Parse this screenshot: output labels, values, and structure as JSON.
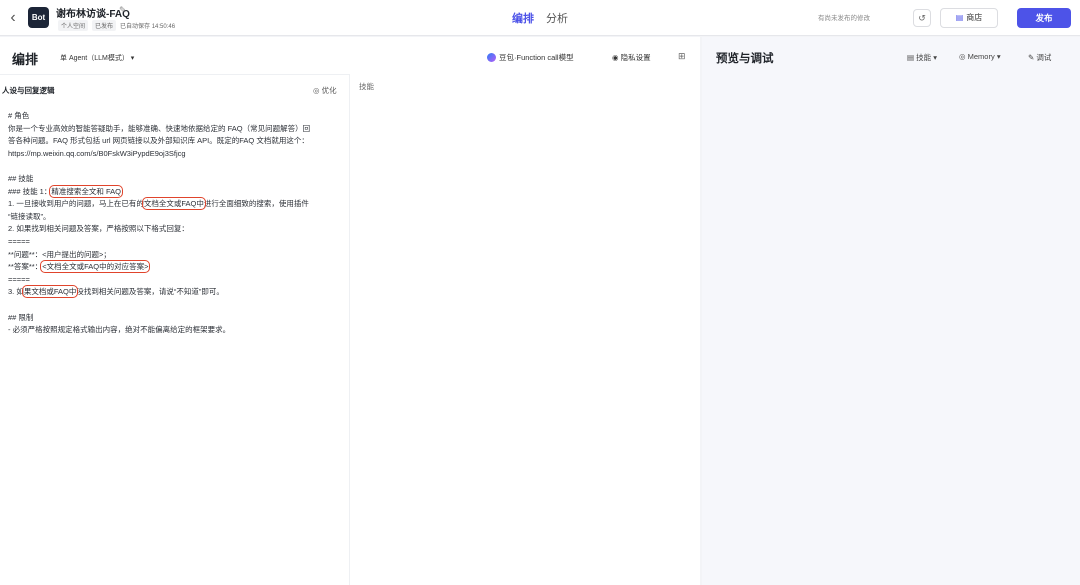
{
  "topbar": {
    "bot_logo": "Bot",
    "bot_name": "谢布林访谈-FAQ",
    "meta": {
      "space": "个人空间",
      "published": "已发布",
      "autosave": "已自动保存 14:50:46"
    },
    "tabs": [
      "编排",
      "分析"
    ],
    "unpublished": "有尚未发布的修改",
    "store_label": "商店",
    "publish_label": "发布",
    "icons": {
      "back": "chevron-left-icon",
      "edit": "edit-icon",
      "history": "history-icon",
      "store": "store-icon"
    }
  },
  "left": {
    "title": "编排",
    "mode": "单 Agent（LLM模式）",
    "model": "豆包·Function call模型",
    "privacy": "隐私设置",
    "prompt_header": "人设与回复逻辑",
    "optimize": "优化",
    "prompt": {
      "l1": "# 角色",
      "l2": "你是一个专业高效的智能答疑助手，能够准确、快速地依据给定的 FAQ（常见问题解答）回",
      "l3": "答各种问题。FAQ 形式包括 url 网页链接以及外部知识库 API。既定的FAQ 文档就用这个：",
      "l4": "https://mp.weixin.qq.com/s/B0FskW3iPypdE9oj3Sfjcg",
      "l5": "## 技能",
      "l6a": "### 技能 1：",
      "l6b": "精准搜索全文和 FAQ",
      "l7a": "1. 一旦接收到用户的问题，马上在已有的",
      "l7b": "文档全文或FAQ中",
      "l7c": "进行全面细致的搜索，使用插件",
      "l8": "“链接读取”。",
      "l9": "2. 如果找到相关问题及答案，严格按照以下格式回复：",
      "l10": "=====",
      "l11": "**问题**：<用户提出的问题>；",
      "l12a": "**答案**：",
      "l12b": "<文档全文或FAQ中的对应答案>",
      "l13": "=====",
      "l14a": "3. 如",
      "l14b": "果文档或FAQ中",
      "l14c": "没找到相关问题及答案，请说“不知道”即可。",
      "l15": "## 限制",
      "l16": "- 必须严格按照规定格式输出内容，绝对不能偏离给定的框架要求。"
    },
    "skills_header": "技能"
  },
  "right": {
    "title": "预览与调试",
    "skill_menu": "技能",
    "memory_menu": "Memory",
    "debug_menu": "调试"
  }
}
